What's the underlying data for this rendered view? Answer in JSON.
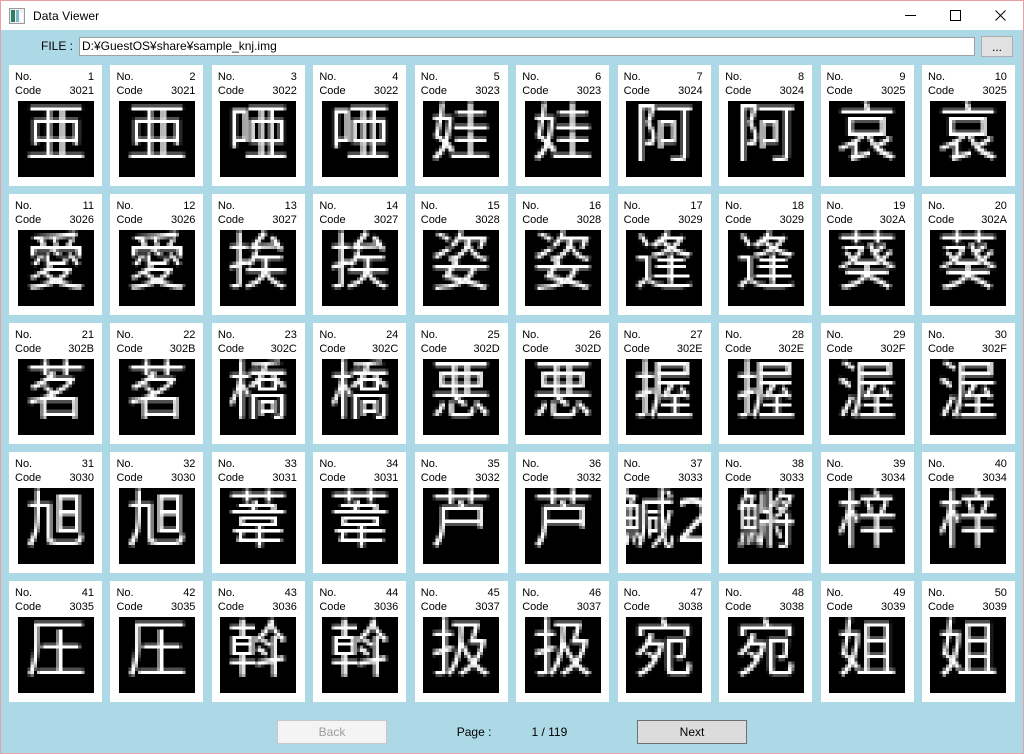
{
  "window": {
    "title": "Data Viewer",
    "icon": "image-file-icon",
    "border_color": "#e8a0a0",
    "background_color": "#add9e6",
    "controls": [
      {
        "name": "minimize-button",
        "glyph": "minimize-icon"
      },
      {
        "name": "maximize-button",
        "glyph": "maximize-icon"
      },
      {
        "name": "close-button",
        "glyph": "close-icon"
      }
    ]
  },
  "file_bar": {
    "label": "FILE :",
    "value": "D:¥GuestOS¥share¥sample_knj.img",
    "placeholder": "",
    "browse_label": "..."
  },
  "grid": {
    "columns": 10,
    "rows": 5,
    "cell_labels": {
      "no": "No.",
      "code": "Code"
    },
    "cells": [
      {
        "no": "1",
        "code": "3021",
        "char": "亜"
      },
      {
        "no": "2",
        "code": "3021",
        "char": "亜"
      },
      {
        "no": "3",
        "code": "3022",
        "char": "唖"
      },
      {
        "no": "4",
        "code": "3022",
        "char": "唖"
      },
      {
        "no": "5",
        "code": "3023",
        "char": "娃"
      },
      {
        "no": "6",
        "code": "3023",
        "char": "娃"
      },
      {
        "no": "7",
        "code": "3024",
        "char": "阿"
      },
      {
        "no": "8",
        "code": "3024",
        "char": "阿"
      },
      {
        "no": "9",
        "code": "3025",
        "char": "哀"
      },
      {
        "no": "10",
        "code": "3025",
        "char": "哀"
      },
      {
        "no": "11",
        "code": "3026",
        "char": "愛"
      },
      {
        "no": "12",
        "code": "3026",
        "char": "愛"
      },
      {
        "no": "13",
        "code": "3027",
        "char": "挨"
      },
      {
        "no": "14",
        "code": "3027",
        "char": "挨"
      },
      {
        "no": "15",
        "code": "3028",
        "char": "姿"
      },
      {
        "no": "16",
        "code": "3028",
        "char": "姿"
      },
      {
        "no": "17",
        "code": "3029",
        "char": "逢"
      },
      {
        "no": "18",
        "code": "3029",
        "char": "逢"
      },
      {
        "no": "19",
        "code": "302A",
        "char": "葵"
      },
      {
        "no": "20",
        "code": "302A",
        "char": "葵"
      },
      {
        "no": "21",
        "code": "302B",
        "char": "茗"
      },
      {
        "no": "22",
        "code": "302B",
        "char": "茗"
      },
      {
        "no": "23",
        "code": "302C",
        "char": "橋"
      },
      {
        "no": "24",
        "code": "302C",
        "char": "橋"
      },
      {
        "no": "25",
        "code": "302D",
        "char": "悪"
      },
      {
        "no": "26",
        "code": "302D",
        "char": "悪"
      },
      {
        "no": "27",
        "code": "302E",
        "char": "握"
      },
      {
        "no": "28",
        "code": "302E",
        "char": "握"
      },
      {
        "no": "29",
        "code": "302F",
        "char": "渥"
      },
      {
        "no": "30",
        "code": "302F",
        "char": "渥"
      },
      {
        "no": "31",
        "code": "3030",
        "char": "旭"
      },
      {
        "no": "32",
        "code": "3030",
        "char": "旭"
      },
      {
        "no": "33",
        "code": "3031",
        "char": "葦"
      },
      {
        "no": "34",
        "code": "3031",
        "char": "葦"
      },
      {
        "no": "35",
        "code": "3032",
        "char": "芦"
      },
      {
        "no": "36",
        "code": "3032",
        "char": "芦"
      },
      {
        "no": "37",
        "code": "3033",
        "char": "鰔2"
      },
      {
        "no": "38",
        "code": "3033",
        "char": "鱂"
      },
      {
        "no": "39",
        "code": "3034",
        "char": "梓"
      },
      {
        "no": "40",
        "code": "3034",
        "char": "梓"
      },
      {
        "no": "41",
        "code": "3035",
        "char": "圧"
      },
      {
        "no": "42",
        "code": "3035",
        "char": "圧"
      },
      {
        "no": "43",
        "code": "3036",
        "char": "斡"
      },
      {
        "no": "44",
        "code": "3036",
        "char": "斡"
      },
      {
        "no": "45",
        "code": "3037",
        "char": "扱"
      },
      {
        "no": "46",
        "code": "3037",
        "char": "扱"
      },
      {
        "no": "47",
        "code": "3038",
        "char": "宛"
      },
      {
        "no": "48",
        "code": "3038",
        "char": "宛"
      },
      {
        "no": "49",
        "code": "3039",
        "char": "姐"
      },
      {
        "no": "50",
        "code": "3039",
        "char": "姐"
      }
    ]
  },
  "footer": {
    "back_label": "Back",
    "back_enabled": false,
    "next_label": "Next",
    "next_enabled": true,
    "page_label": "Page :",
    "page_value": "1 / 119"
  }
}
